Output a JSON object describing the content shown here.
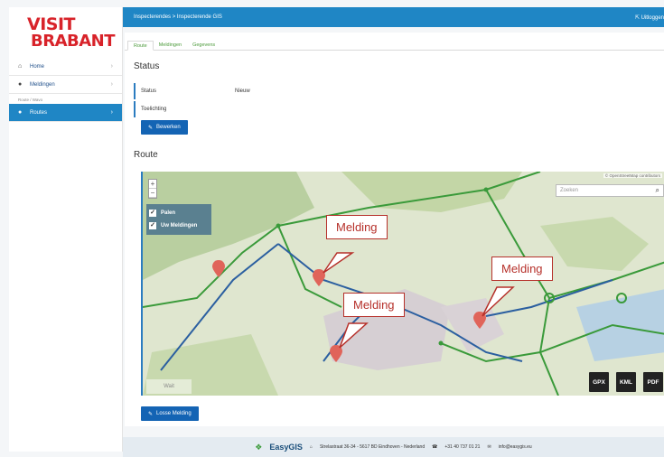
{
  "logo": {
    "line1": "VISIT",
    "line2": "BRABANT"
  },
  "sidebar": {
    "items": [
      {
        "label": "Home"
      },
      {
        "label": "Meldingen"
      }
    ],
    "section_label": "Route / Wavo",
    "active": {
      "label": "Routes"
    }
  },
  "topbar": {
    "breadcrumb": "Inspecterendes > Inspecterende GIS",
    "logout": "Uitloggen"
  },
  "tabs": [
    {
      "label": "Route"
    },
    {
      "label": "Meldingen"
    },
    {
      "label": "Gegevens"
    }
  ],
  "status": {
    "heading": "Status",
    "status_label": "Status",
    "status_value": "Nieuw",
    "comment_label": "Toelichting",
    "edit_button": "Bewerken"
  },
  "route": {
    "heading": "Route"
  },
  "map": {
    "attribution": "© OpenStreetMap contributors",
    "search_placeholder": "Zoeken",
    "layers": [
      {
        "label": "Palen",
        "checked": true
      },
      {
        "label": "Uw Meldingen",
        "checked": true
      }
    ],
    "zoom_in": "+",
    "zoom_out": "−",
    "callouts": [
      "Melding",
      "Melding",
      "Melding"
    ],
    "exports": [
      "GPX",
      "KML",
      "PDF"
    ],
    "waiting_label": "Wait"
  },
  "actions": {
    "new_report": "Losse Melding"
  },
  "footer": {
    "brand": "EasyGIS",
    "address": "Strelastraat 36-34 - 5617 BD Eindhoven - Nederland",
    "phone": "+31 40 737 01 21",
    "email": "info@easygis.eu"
  },
  "colors": {
    "brand_red": "#d8232a",
    "primary_blue": "#1f86c5",
    "button_blue": "#1464b4",
    "route_green": "#3a9a3a",
    "route_blue": "#2b5fa0",
    "marker_red": "#e0645a"
  }
}
